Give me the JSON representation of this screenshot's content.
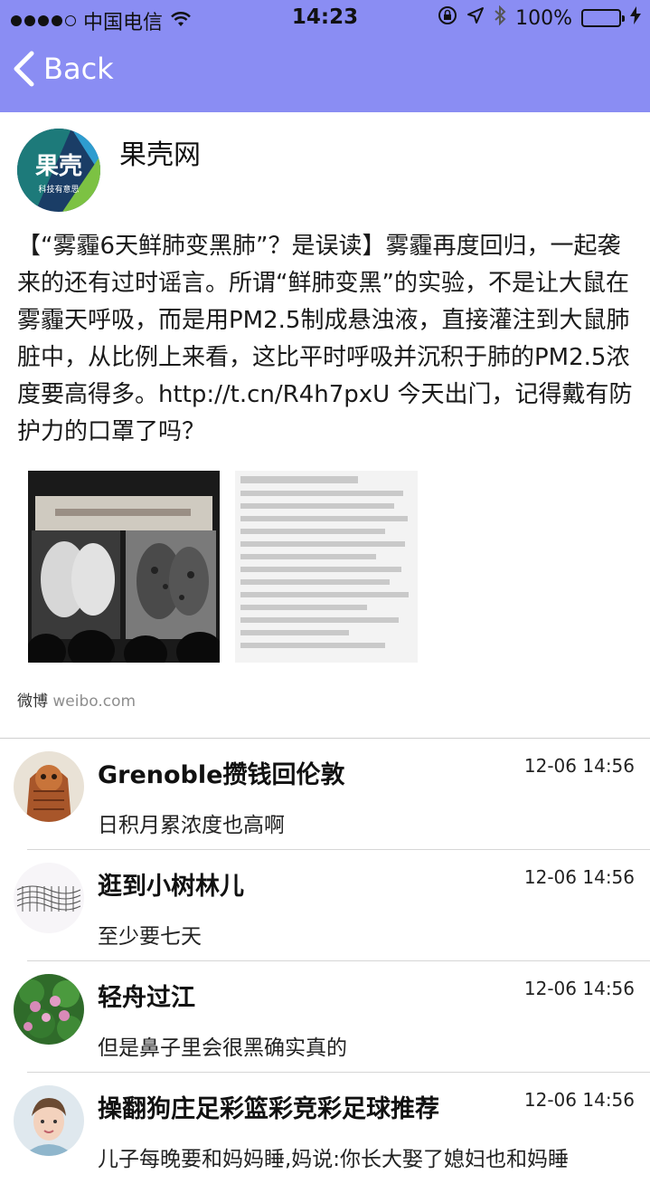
{
  "status_bar": {
    "carrier": "中国电信",
    "time": "14:23",
    "battery_percent": "100%"
  },
  "nav": {
    "back_label": "Back"
  },
  "post": {
    "author": "果壳网",
    "avatar_logo_text": "果壳",
    "avatar_logo_subtext": "科技有意思",
    "text": "【“雾霾6天鲜肺变黑肺”？是误读】雾霾再度回归，一起袭来的还有过时谣言。所谓“鲜肺变黑”的实验，不是让大鼠在雾霾天呼吸，而是用PM2.5制成悬浊液，直接灌注到大鼠肺脏中，从比例上来看，这比平时呼吸并沉积于肺的PM2.5浓度要高得多。http://t.cn/R4h7pxU 今天出门，记得戴有防护力的口罩了吗？",
    "source_label": "微博",
    "source_domain": "weibo.com"
  },
  "comments": [
    {
      "name": "Grenoble攒钱回伦敦",
      "time": "12-06 14:56",
      "text": "日积月累浓度也高啊"
    },
    {
      "name": "逛到小树林儿",
      "time": "12-06 14:56",
      "text": "至少要七天"
    },
    {
      "name": "轻舟过江",
      "time": "12-06 14:56",
      "text": "但是鼻子里会很黑确实真的"
    },
    {
      "name": "操翻狗庄足彩篮彩竞彩足球推荐",
      "time": "12-06 14:56",
      "text": "儿子每晚要和妈妈睡,妈说:你长大娶了媳妇也和妈睡"
    }
  ],
  "colors": {
    "nav_bg": "#8a8df3",
    "battery": "#4cd964"
  }
}
